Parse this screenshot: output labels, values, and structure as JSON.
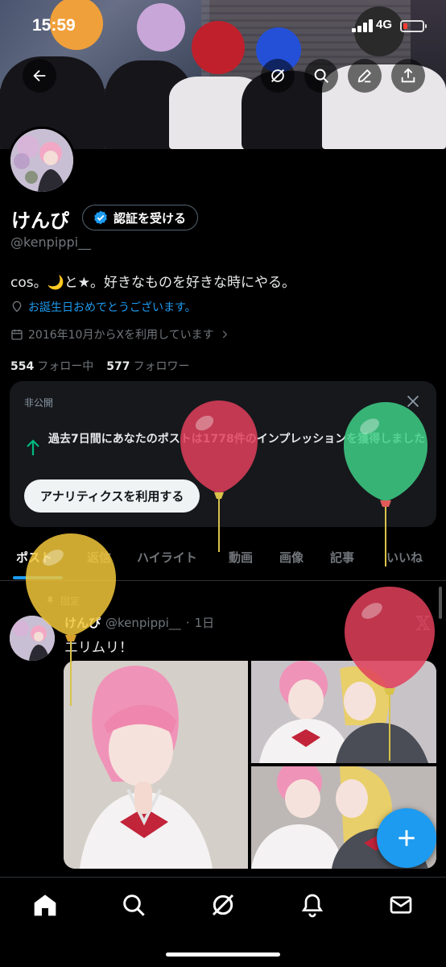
{
  "status_bar": {
    "time": "15:59",
    "network": "4G"
  },
  "profile": {
    "display_name": "けんぴ",
    "verify_button": "認証を受ける",
    "handle": "@kenpippi__",
    "bio": "cos。🌙と★。好きなものを好きな時にやる。",
    "birthday_text": "お誕生日おめでとうございます。",
    "joined_text": "2016年10月からXを利用しています",
    "following_count": "554",
    "following_label": "フォロー中",
    "followers_count": "577",
    "followers_label": "フォロワー"
  },
  "analytics_card": {
    "private_label": "非公開",
    "message": "過去7日間にあなたのポストは1778件のインプレッションを獲得しました",
    "button_label": "アナリティクスを利用する"
  },
  "tabs": [
    {
      "label": "ポスト",
      "active": true
    },
    {
      "label": "返信",
      "active": false
    },
    {
      "label": "ハイライト",
      "active": false
    },
    {
      "label": "動画",
      "active": false
    },
    {
      "label": "画像",
      "active": false
    },
    {
      "label": "記事",
      "active": false
    },
    {
      "label": "いいね",
      "active": false
    }
  ],
  "tweet": {
    "pinned_label": "固定",
    "author_name": "けんぴ",
    "author_handle": "@kenpippi__",
    "time": "1日",
    "text": "エリムリ！"
  },
  "icons": {
    "back": "back-arrow-icon",
    "grok": "grok-icon",
    "search": "search-icon",
    "edit": "edit-icon",
    "share": "share-icon",
    "verified": "verified-badge-icon",
    "location": "balloon-location-icon",
    "calendar": "calendar-icon",
    "close": "close-icon",
    "up_arrow": "up-arrow-icon",
    "pin": "pin-icon",
    "compose": "plus-icon",
    "nav": [
      "home-icon",
      "search-icon",
      "grok-icon",
      "bell-icon",
      "mail-icon"
    ]
  },
  "colors": {
    "accent": "#1d9bf0",
    "background": "#000000",
    "card": "#16181c",
    "muted": "#71767b",
    "positive": "#00ba7c",
    "balloon_red": "#e0405a",
    "balloon_green": "#3ecf86",
    "balloon_yellow": "#f2c73a"
  }
}
